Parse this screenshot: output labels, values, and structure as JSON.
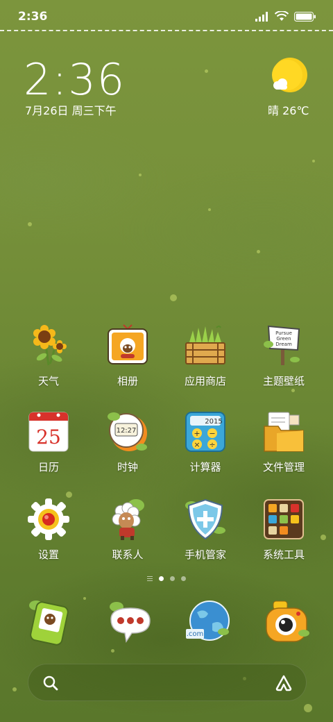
{
  "status_bar": {
    "time": "2:36",
    "icons": [
      "signal-icon",
      "wifi-icon",
      "battery-icon"
    ]
  },
  "clock_widget": {
    "time": "2:36",
    "date": "7月26日 周三下午"
  },
  "weather_widget": {
    "condition": "晴",
    "temperature": "26℃",
    "text": "晴 26℃",
    "icon": "sun-cloud-icon"
  },
  "apps": [
    {
      "label": "天气",
      "icon": "sunflower-icon"
    },
    {
      "label": "相册",
      "icon": "sheep-frame-icon"
    },
    {
      "label": "应用商店",
      "icon": "grass-crate-icon"
    },
    {
      "label": "主题壁纸",
      "icon": "signpost-icon"
    },
    {
      "label": "日历",
      "icon": "calendar-icon",
      "badge": "25"
    },
    {
      "label": "时钟",
      "icon": "clock-icon",
      "badge": "12:27"
    },
    {
      "label": "计算器",
      "icon": "calculator-icon",
      "badge": "2015"
    },
    {
      "label": "文件管理",
      "icon": "folder-icon"
    },
    {
      "label": "设置",
      "icon": "gear-icon"
    },
    {
      "label": "联系人",
      "icon": "sheep-contact-icon"
    },
    {
      "label": "手机管家",
      "icon": "shield-icon"
    },
    {
      "label": "系统工具",
      "icon": "toolbox-icon"
    }
  ],
  "page_indicator": {
    "pages": 3,
    "active": 1
  },
  "dock": [
    {
      "name": "phone",
      "icon": "phone-icon"
    },
    {
      "name": "messages",
      "icon": "message-bubble-icon"
    },
    {
      "name": "browser",
      "icon": "globe-icon",
      "badge": ".com"
    },
    {
      "name": "camera",
      "icon": "camera-icon"
    }
  ],
  "search_bar": {
    "icon": "search-icon",
    "assistant_icon": "assistant-icon"
  }
}
